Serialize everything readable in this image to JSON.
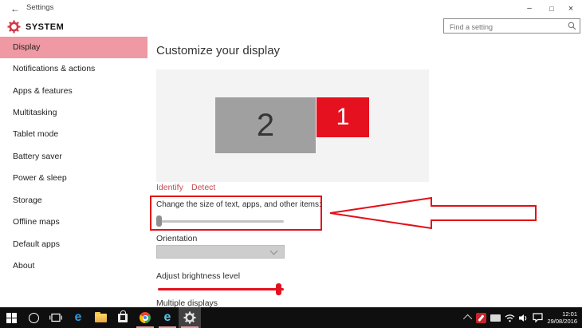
{
  "titlebar": {
    "app_title": "Settings",
    "window_controls": {
      "minimize": "–",
      "maximize": "□",
      "close": "×"
    }
  },
  "header": {
    "title": "SYSTEM"
  },
  "search": {
    "placeholder": "Find a setting"
  },
  "sidebar": {
    "items": [
      {
        "label": "Display",
        "selected": true
      },
      {
        "label": "Notifications & actions",
        "selected": false
      },
      {
        "label": "Apps & features",
        "selected": false
      },
      {
        "label": "Multitasking",
        "selected": false
      },
      {
        "label": "Tablet mode",
        "selected": false
      },
      {
        "label": "Battery saver",
        "selected": false
      },
      {
        "label": "Power & sleep",
        "selected": false
      },
      {
        "label": "Storage",
        "selected": false
      },
      {
        "label": "Offline maps",
        "selected": false
      },
      {
        "label": "Default apps",
        "selected": false
      },
      {
        "label": "About",
        "selected": false
      }
    ]
  },
  "main": {
    "heading": "Customize your display",
    "monitors": [
      {
        "label": "2"
      },
      {
        "label": "1"
      }
    ],
    "identify_link": "Identify",
    "detect_link": "Detect",
    "scale_section": {
      "label": "Change the size of text, apps, and other items:",
      "slider_value_percent": 0
    },
    "orientation_section": {
      "label": "Orientation",
      "selected_option": ""
    },
    "brightness_section": {
      "label": "Adjust brightness level",
      "slider_value_percent": 96
    },
    "multiple_displays_heading": "Multiple displays"
  },
  "annotations": {
    "highlight_box": "scale-section",
    "arrow_direction": "left"
  },
  "taskbar": {
    "pinned_icons": [
      "start",
      "cortana",
      "task-view",
      "edge",
      "file-explorer",
      "store",
      "chrome",
      "internet-explorer",
      "settings"
    ],
    "active_app": "settings",
    "running_apps": [
      "chrome",
      "internet-explorer",
      "settings"
    ],
    "tray_icons": [
      "hidden-icons-chevron",
      "antivirus",
      "touch-keyboard",
      "wifi",
      "volume",
      "action-center"
    ],
    "clock": {
      "time": "12:01",
      "date": "29/08/2016"
    }
  },
  "colors": {
    "accent_red": "#e6111f",
    "annotation_red": "#e30e17",
    "link_red": "#c5494f",
    "sidebar_highlight": "#ee99a3",
    "monitor_gray": "#a0a0a0",
    "panel_gray": "#f3f3f3",
    "taskbar_black": "#0f0f0f",
    "edge_blue": "#2f9ae3",
    "ie_blue": "#53c7f0"
  }
}
